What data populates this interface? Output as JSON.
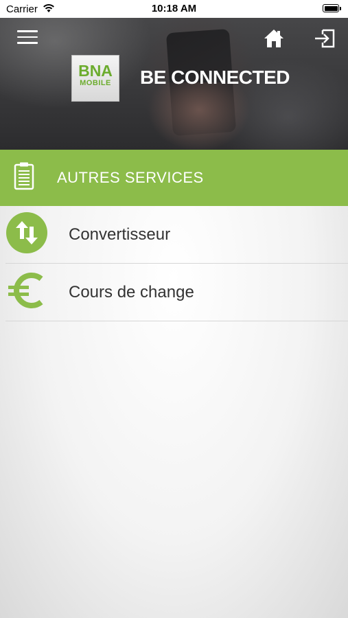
{
  "status_bar": {
    "carrier": "Carrier",
    "time": "10:18 AM"
  },
  "header": {
    "logo_line1": "BNA",
    "logo_line2": "MOBILE",
    "tagline": "BE CONNECTED",
    "icons": [
      "menu-icon",
      "home-icon",
      "logout-icon"
    ]
  },
  "section": {
    "title": "AUTRES SERVICES",
    "icon": "clipboard-icon"
  },
  "menu_items": [
    {
      "label": "Convertisseur",
      "icon": "convert-arrows-icon"
    },
    {
      "label": "Cours de change",
      "icon": "euro-icon"
    }
  ],
  "colors": {
    "accent_green": "#8cbc4a",
    "icon_green": "#8cbc4a",
    "logo_green": "#6cac2e"
  }
}
